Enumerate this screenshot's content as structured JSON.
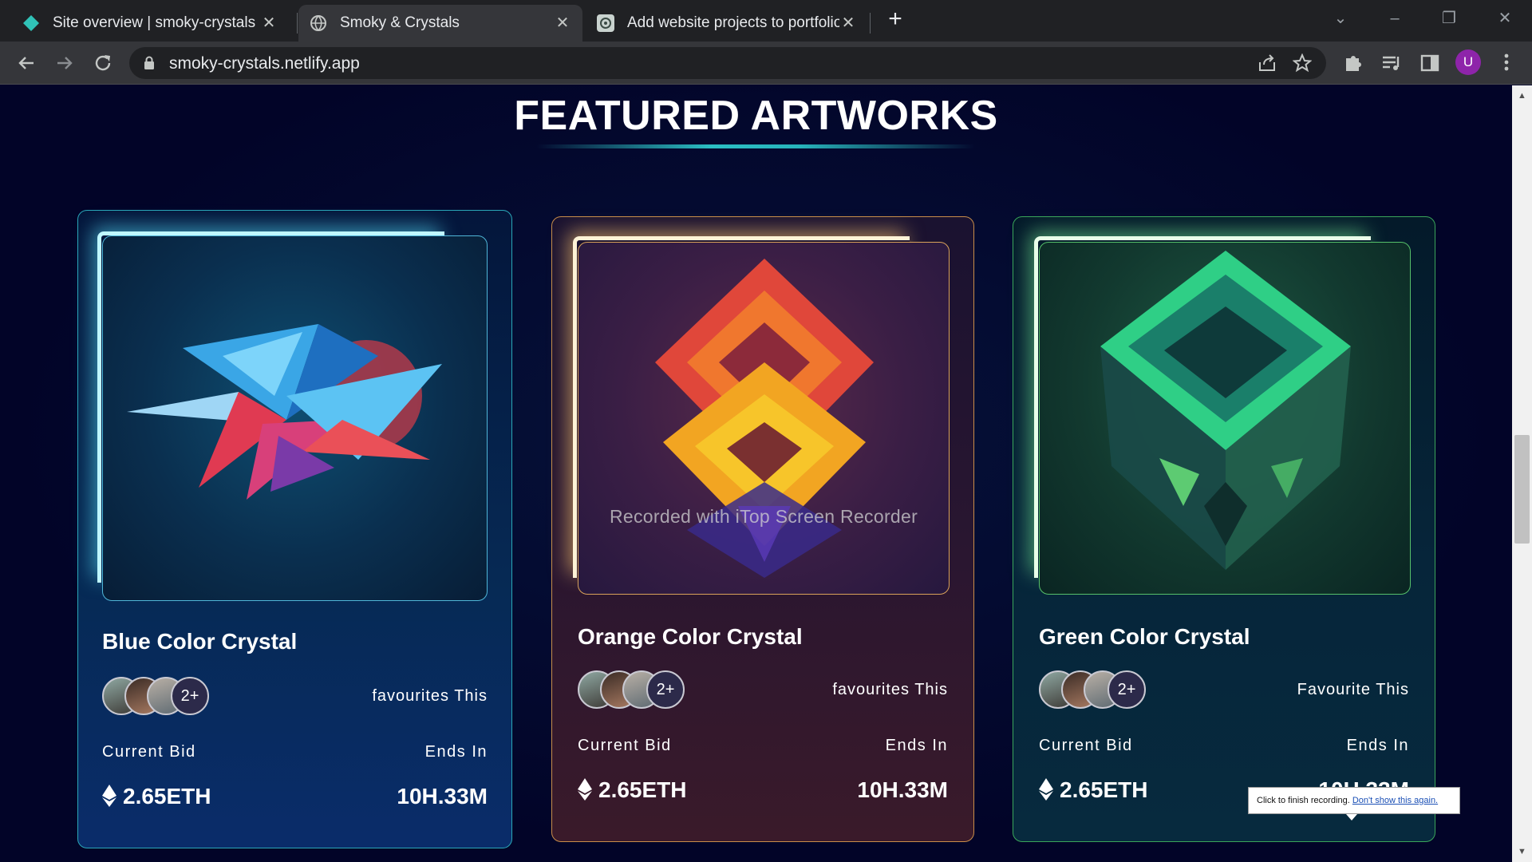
{
  "browser": {
    "tabs": [
      {
        "title": "Site overview | smoky-crystals",
        "icon": "netlify-icon"
      },
      {
        "title": "Smoky & Crystals",
        "icon": "globe-icon"
      },
      {
        "title": "Add website projects to portfolio",
        "icon": "chatgpt-icon"
      }
    ],
    "url": "smoky-crystals.netlify.app",
    "profile_initial": "U"
  },
  "page": {
    "section_title": "FEATURED ARTWORKS",
    "cards": [
      {
        "name": "Blue Color Crystal",
        "more_count": "2+",
        "favourite_label": "favourites This",
        "bid_label": "Current Bid",
        "ends_label": "Ends In",
        "bid_value": "2.65ETH",
        "ends_value": "10H.33M",
        "accent": "#2bbfc4"
      },
      {
        "name": "Orange Color Crystal",
        "more_count": "2+",
        "favourite_label": "favourites This",
        "bid_label": "Current Bid",
        "ends_label": "Ends In",
        "bid_value": "2.65ETH",
        "ends_value": "10H.33M",
        "accent": "#e0a84a"
      },
      {
        "name": "Green Color Crystal",
        "more_count": "2+",
        "favourite_label": "Favourite This",
        "bid_label": "Current Bid",
        "ends_label": "Ends In",
        "bid_value": "2.65ETH",
        "ends_value": "10H.33M",
        "accent": "#3fcf7a"
      }
    ]
  },
  "overlay": {
    "watermark": "Recorded with iTop Screen Recorder",
    "tooltip_text": "Click to finish recording.",
    "tooltip_link": "Don't show this again."
  }
}
